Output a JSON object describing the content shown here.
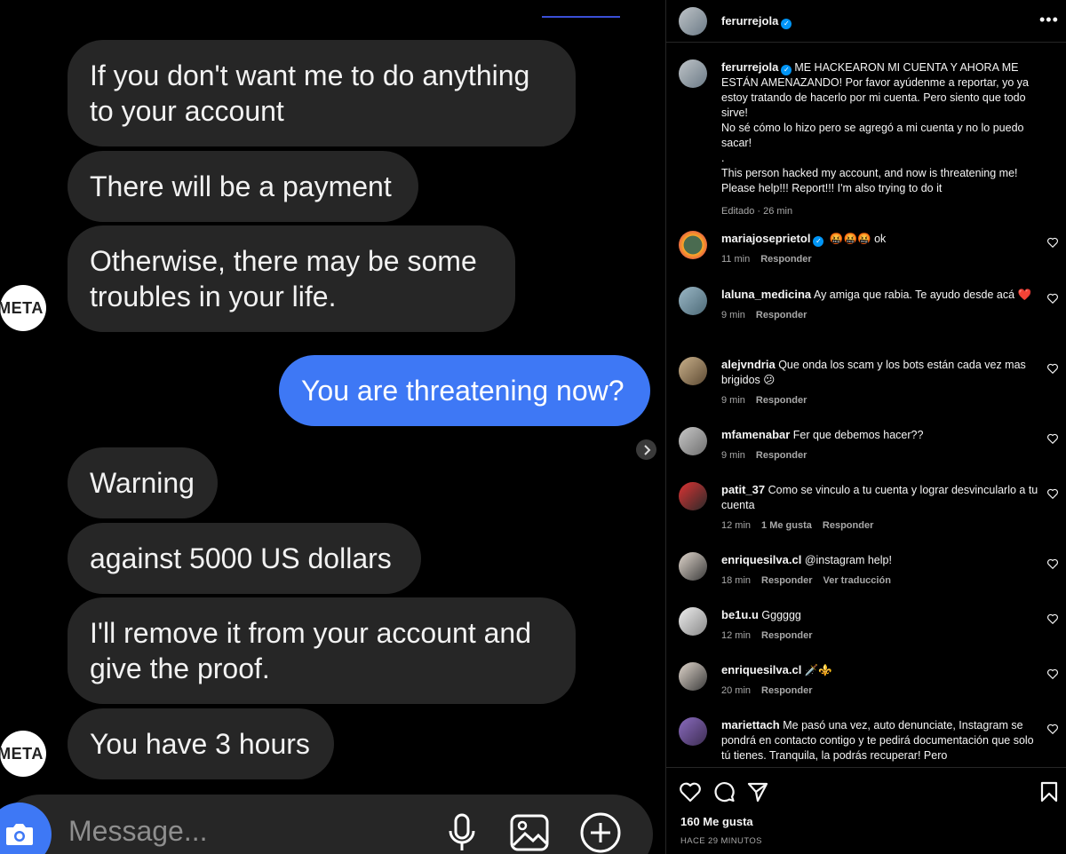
{
  "chat": {
    "messages": [
      {
        "text": "If you don't want me to do anything\nto your account",
        "from": "them"
      },
      {
        "text": "There will be a payment",
        "from": "them"
      },
      {
        "text": "Otherwise, there may be some\ntroubles in your life.",
        "from": "them"
      },
      {
        "text": "You are threatening now?",
        "from": "me"
      },
      {
        "text": "Warning",
        "from": "them"
      },
      {
        "text": "against 5000 US dollars",
        "from": "them"
      },
      {
        "text": "I'll remove it from your account and\ngive the proof.",
        "from": "them"
      },
      {
        "text": "You have 3 hours",
        "from": "them"
      }
    ],
    "sender_avatar_text": "META",
    "composer": {
      "placeholder": "Message..."
    },
    "colors": {
      "bubble_them": "#262626",
      "bubble_me": "#3e78f5",
      "background": "#000000"
    }
  },
  "post": {
    "header": {
      "username": "ferurrejola",
      "verified": true,
      "more_icon": "more-dots-icon"
    },
    "caption": {
      "username": "ferurrejola",
      "lines": [
        "ME HACKEARON MI CUENTA Y AHORA ME ESTÁN AMENAZANDO! Por favor ayúdenme a reportar, yo ya estoy tratando de hacerlo por mi cuenta. Pero siento que todo sirve!",
        "No sé cómo lo hizo pero se agregó a mi cuenta y no lo puedo sacar!",
        ".",
        "This person hacked my account, and now is threatening me! Please help!!! Report!!! I'm also trying to do it"
      ],
      "meta": "Editado · 26 min"
    },
    "comments": [
      {
        "user": "mariajoseprietol",
        "verified": true,
        "text": "🤬🤬🤬 ok",
        "time": "11 min",
        "likes": "",
        "reply": "Responder",
        "extra": ""
      },
      {
        "user": "laluna_medicina",
        "verified": false,
        "text": "Ay amiga que rabia. Te ayudo desde acá ❤️",
        "time": "9 min",
        "likes": "",
        "reply": "Responder",
        "extra": ""
      },
      {
        "user": "alejvndria",
        "verified": false,
        "text": "Que onda los scam y los bots están cada vez mas brigidos 😕",
        "time": "9 min",
        "likes": "",
        "reply": "Responder",
        "extra": ""
      },
      {
        "user": "mfamenabar",
        "verified": false,
        "text": "Fer que debemos hacer??",
        "time": "9 min",
        "likes": "",
        "reply": "Responder",
        "extra": ""
      },
      {
        "user": "patit_37",
        "verified": false,
        "text": "Como se vinculo a tu cuenta y lograr desvincularlo a tu cuenta",
        "time": "12 min",
        "likes": "1 Me gusta",
        "reply": "Responder",
        "extra": ""
      },
      {
        "user": "enriquesilva.cl",
        "verified": false,
        "text": "@instagram help!",
        "time": "18 min",
        "likes": "",
        "reply": "Responder",
        "extra": "Ver traducción"
      },
      {
        "user": "be1u.u",
        "verified": false,
        "text": "Gggggg",
        "time": "12 min",
        "likes": "",
        "reply": "Responder",
        "extra": ""
      },
      {
        "user": "enriquesilva.cl",
        "verified": false,
        "text": "🗡️⚜️",
        "time": "20 min",
        "likes": "",
        "reply": "Responder",
        "extra": ""
      },
      {
        "user": "mariettach",
        "verified": false,
        "text": "Me pasó una vez, auto denunciate, Instagram se pondrá en contacto contigo y te pedirá documentación que solo tú tienes. Tranquila, la podrás recuperar! Pero",
        "time": "",
        "likes": "",
        "reply": "",
        "extra": ""
      }
    ],
    "likes_count": "160 Me gusta",
    "posted_ago": "HACE 29 MINUTOS",
    "colors": {
      "verified": "#0095f6",
      "secondary_text": "#a8a8a8",
      "divider": "#262626"
    }
  }
}
